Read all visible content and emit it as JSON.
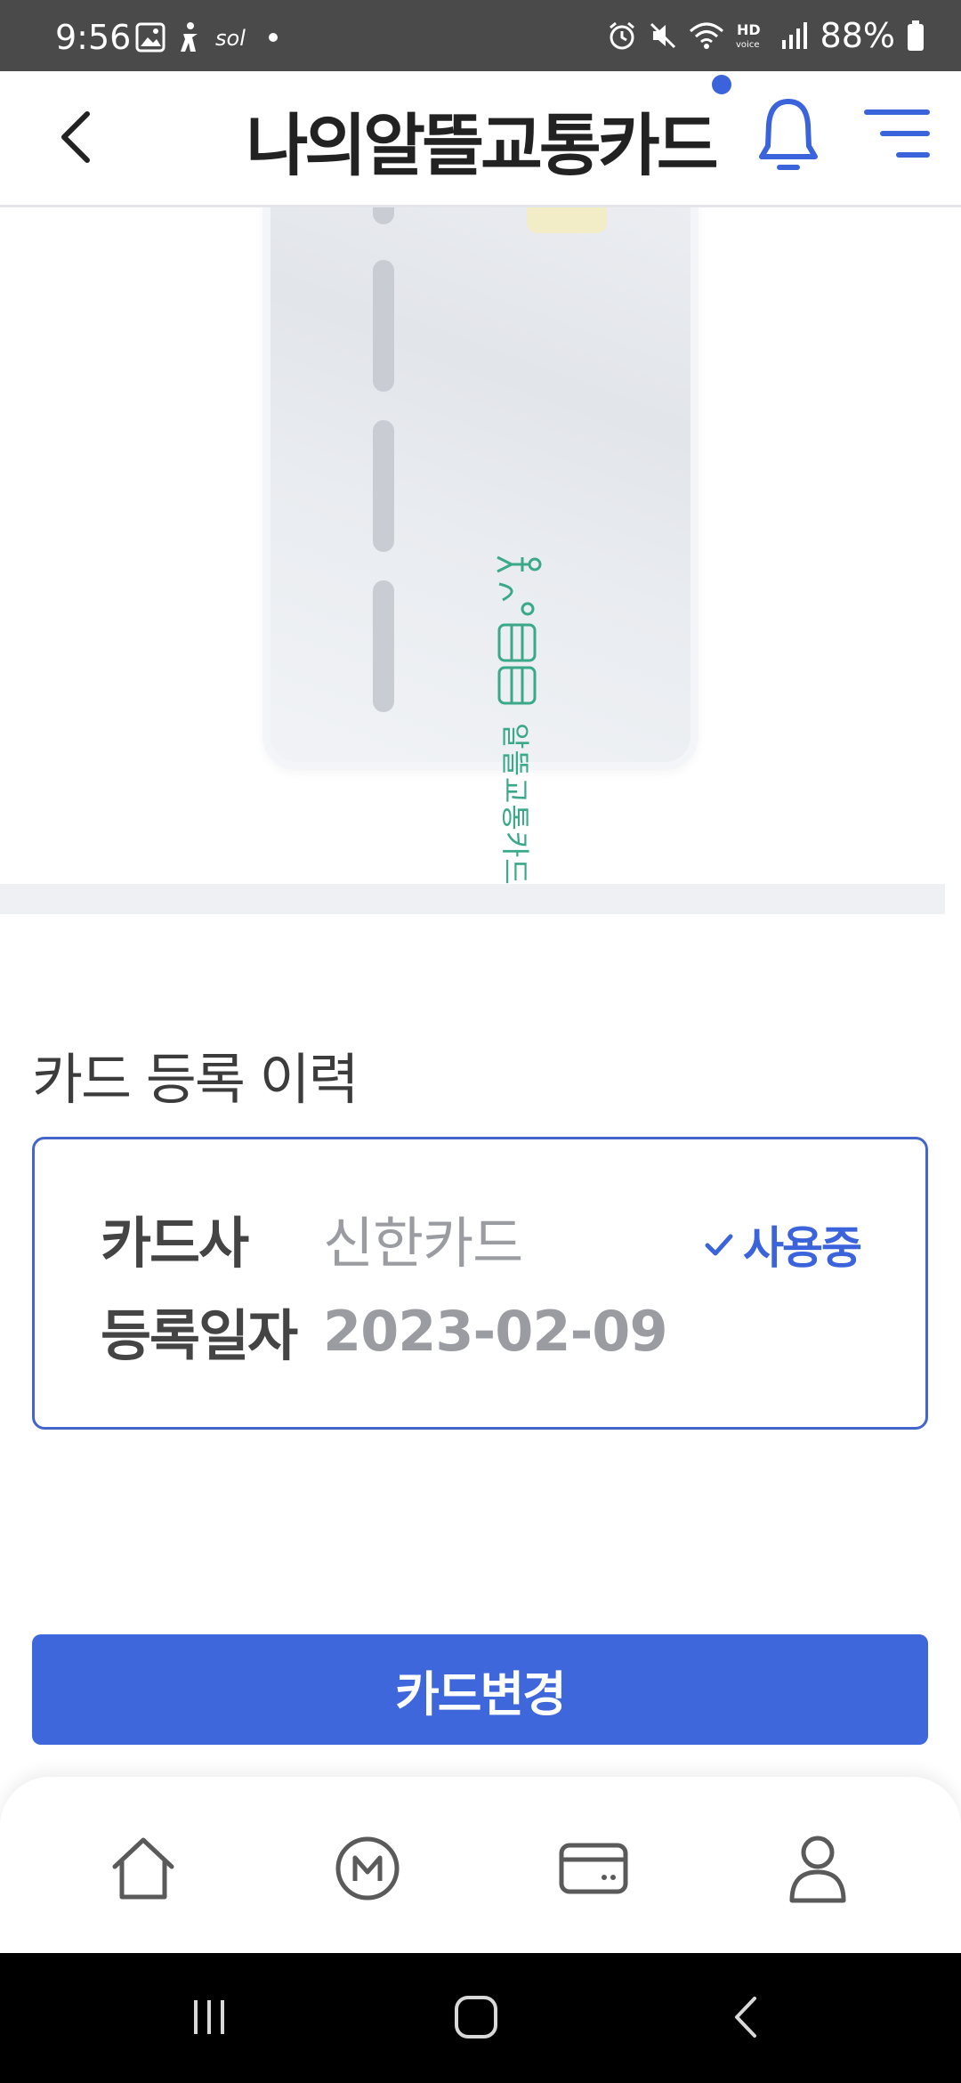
{
  "status_bar": {
    "time": "9:56",
    "battery": "88%",
    "icons": [
      "image-icon",
      "accessibility-icon",
      "sol-icon",
      "dot-icon",
      "alarm-icon",
      "mute-icon",
      "wifi-icon",
      "hd-voice-icon",
      "signal-icon",
      "battery-icon"
    ]
  },
  "header": {
    "title": "나의알뜰교통카드",
    "has_notification": true,
    "accent_color": "#3b63db"
  },
  "card": {
    "logo_text": "알뜰교통카드",
    "logo_symbol": "+"
  },
  "history": {
    "section_title": "카드 등록 이력",
    "company_label": "카드사",
    "company_value": "신한카드",
    "date_label": "등록일자",
    "date_value": "2023-02-09",
    "status": "사용중"
  },
  "actions": {
    "change_card_label": "카드변경"
  },
  "bottom_nav": {
    "items": [
      "home-icon",
      "mileage-icon",
      "card-icon",
      "profile-icon"
    ]
  },
  "system_nav": {
    "items": [
      "recents-icon",
      "home-button-icon",
      "back-icon"
    ]
  }
}
